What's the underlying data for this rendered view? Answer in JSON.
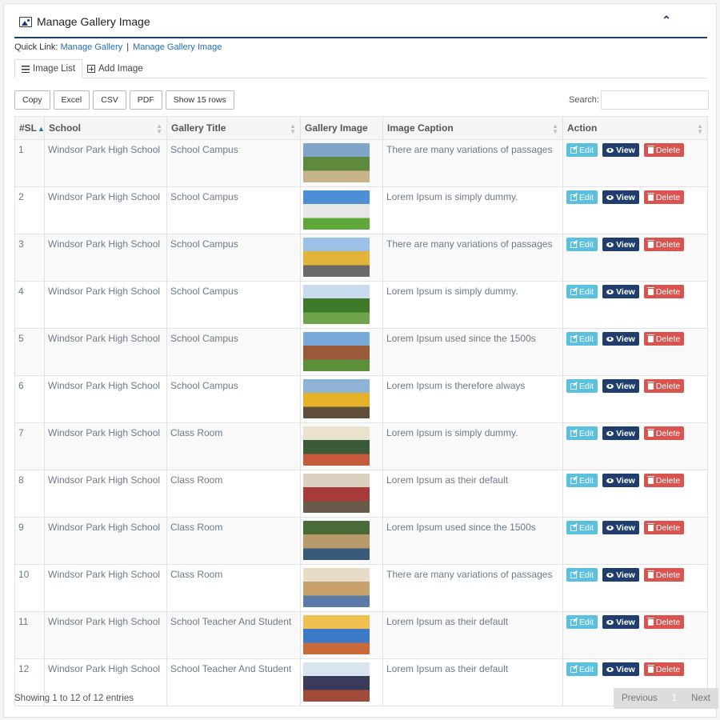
{
  "header": {
    "title": "Manage Gallery Image",
    "collapse_glyph": "⌃"
  },
  "quick_link": {
    "label": "Quick Link:",
    "links": [
      "Manage Gallery",
      "Manage Gallery Image"
    ],
    "separator": "|"
  },
  "tabs": [
    {
      "label": "Image List",
      "icon": "list-icon",
      "active": true
    },
    {
      "label": "Add Image",
      "icon": "plus-square-icon",
      "active": false
    }
  ],
  "export_buttons": [
    "Copy",
    "Excel",
    "CSV",
    "PDF",
    "Show 15 rows"
  ],
  "search": {
    "label": "Search:",
    "value": "",
    "placeholder": ""
  },
  "table": {
    "columns": [
      "#SL",
      "School",
      "Gallery Title",
      "Gallery Image",
      "Image Caption",
      "Action"
    ],
    "sorted_column": "#SL",
    "action_labels": {
      "edit": "Edit",
      "view": "View",
      "delete": "Delete"
    },
    "rows": [
      {
        "sl": "1",
        "school": "Windsor Park High School",
        "title": "School Campus",
        "caption": "There are many variations of passages",
        "image_colors": [
          "#7fa6c8",
          "#5d8a3c",
          "#c6b38a"
        ]
      },
      {
        "sl": "2",
        "school": "Windsor Park High School",
        "title": "School Campus",
        "caption": "Lorem Ipsum is simply dummy.",
        "image_colors": [
          "#4d8fd6",
          "#e8e8e8",
          "#5fa83a"
        ]
      },
      {
        "sl": "3",
        "school": "Windsor Park High School",
        "title": "School Campus",
        "caption": "There are many variations of passages",
        "image_colors": [
          "#9cc1e6",
          "#e2b43a",
          "#6a6a6a"
        ]
      },
      {
        "sl": "4",
        "school": "Windsor Park High School",
        "title": "School Campus",
        "caption": "Lorem Ipsum is simply dummy.",
        "image_colors": [
          "#c9dcef",
          "#3f7a2a",
          "#6fa34a"
        ]
      },
      {
        "sl": "5",
        "school": "Windsor Park High School",
        "title": "School Campus",
        "caption": "Lorem Ipsum used since the 1500s",
        "image_colors": [
          "#79a9d8",
          "#9a5a3a",
          "#5c8f3a"
        ]
      },
      {
        "sl": "6",
        "school": "Windsor Park High School",
        "title": "School Campus",
        "caption": "Lorem Ipsum is therefore always",
        "image_colors": [
          "#8fb3d6",
          "#e6b22a",
          "#5e4e3a"
        ]
      },
      {
        "sl": "7",
        "school": "Windsor Park High School",
        "title": "Class Room",
        "caption": "Lorem Ipsum is simply dummy.",
        "image_colors": [
          "#e9e2cf",
          "#3a5a3a",
          "#c45a3a"
        ]
      },
      {
        "sl": "8",
        "school": "Windsor Park High School",
        "title": "Class Room",
        "caption": "Lorem Ipsum as their default",
        "image_colors": [
          "#d9d0c0",
          "#a83a3a",
          "#6a5a4a"
        ]
      },
      {
        "sl": "9",
        "school": "Windsor Park High School",
        "title": "Class Room",
        "caption": "Lorem Ipsum used since the 1500s",
        "image_colors": [
          "#4a6a3a",
          "#b89a6a",
          "#3a5a7a"
        ]
      },
      {
        "sl": "10",
        "school": "Windsor Park High School",
        "title": "Class Room",
        "caption": "There are many variations of passages",
        "image_colors": [
          "#e6dcc8",
          "#c8a06a",
          "#5a7aa8"
        ]
      },
      {
        "sl": "11",
        "school": "Windsor Park High School",
        "title": "School Teacher And Student",
        "caption": "Lorem Ipsum as their default",
        "image_colors": [
          "#f0c050",
          "#3a7ac8",
          "#c86a3a"
        ]
      },
      {
        "sl": "12",
        "school": "Windsor Park High School",
        "title": "School Teacher And Student",
        "caption": "Lorem Ipsum as their default",
        "image_colors": [
          "#d8e4ee",
          "#3a3a5a",
          "#a04a3a"
        ]
      }
    ]
  },
  "footer": {
    "info": "Showing 1 to 12 of 12 entries",
    "pager": {
      "previous": "Previous",
      "page": "1",
      "next": "Next"
    }
  }
}
